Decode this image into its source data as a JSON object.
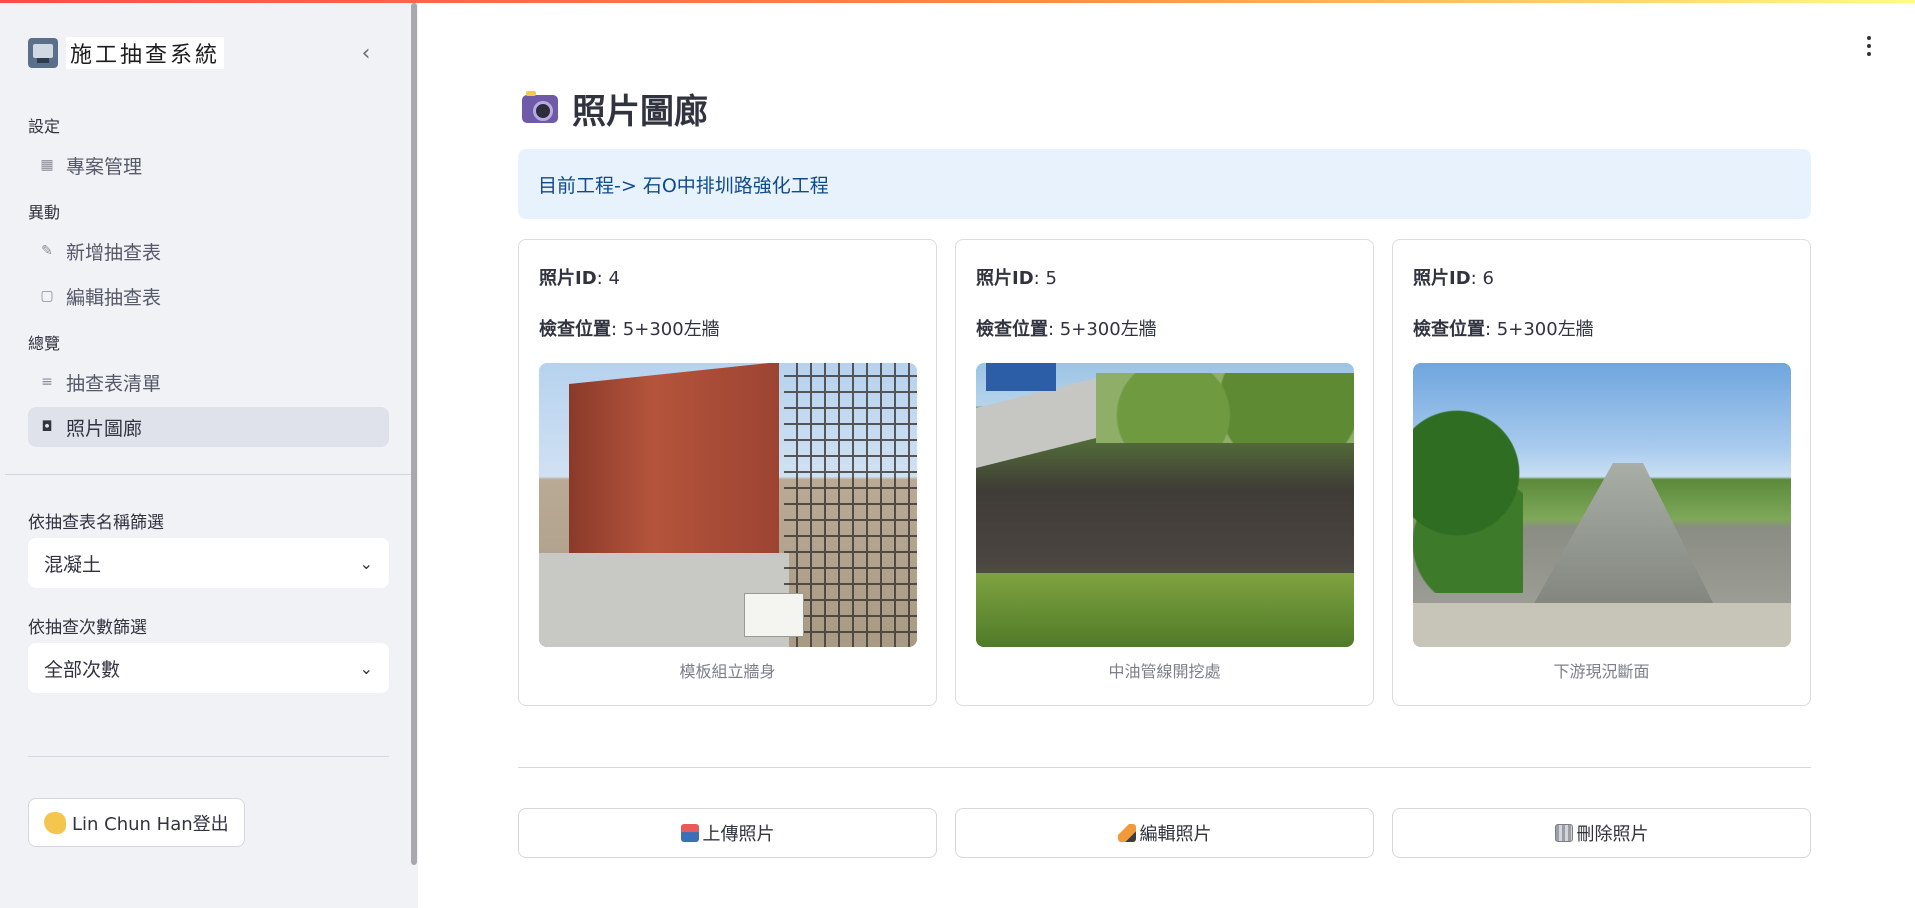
{
  "app": {
    "title": "施工抽查系統"
  },
  "sidebar": {
    "collapse_icon": "chevron-left-icon",
    "sections": {
      "settings": "設定",
      "actions": "異動",
      "overview": "總覽"
    },
    "items": [
      {
        "label": "專案管理",
        "icon": "building-icon"
      },
      {
        "label": "新增抽查表",
        "icon": "pencil-icon"
      },
      {
        "label": "編輯抽查表",
        "icon": "file-edit-icon"
      },
      {
        "label": "抽查表清單",
        "icon": "list-icon"
      },
      {
        "label": "照片圖廊",
        "icon": "image-icon",
        "active": true
      }
    ],
    "filters": {
      "name_label": "依抽查表名稱篩選",
      "name_value": "混凝土",
      "count_label": "依抽查次數篩選",
      "count_value": "全部次數"
    },
    "logout_label": "Lin Chun Han登出"
  },
  "main": {
    "title": "照片圖廊",
    "info": "目前工程-> 石O中排圳路強化工程",
    "photo_id_label": "照片ID",
    "location_label": "檢查位置",
    "cards": [
      {
        "id": "4",
        "location": "5+300左牆",
        "caption": "模板組立牆身"
      },
      {
        "id": "5",
        "location": "5+300左牆",
        "caption": "中油管線開挖處"
      },
      {
        "id": "6",
        "location": "5+300左牆",
        "caption": "下游現況斷面"
      }
    ],
    "buttons": {
      "upload": "上傳照片",
      "edit": "編輯照片",
      "delete": "刪除照片"
    }
  },
  "colors": {
    "sidebar_bg": "#f0f2f6",
    "info_bg": "#e8f2fc",
    "info_text": "#104a8e",
    "accent": "#ff4b4b"
  }
}
